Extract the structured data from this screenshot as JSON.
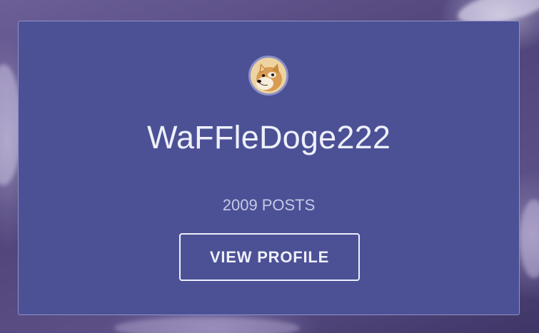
{
  "profile_card": {
    "username": "WaFFleDoge222",
    "post_count": "2009",
    "posts_label": "POSTS",
    "view_profile_label": "VIEW PROFILE",
    "avatar_icon": "doge-avatar-icon"
  },
  "colors": {
    "card_background": "#4c5196",
    "card_border": "#8f93c6",
    "text_primary": "#eef0fa",
    "text_secondary": "#c6c9e6",
    "avatar_ring": "#8d91c7"
  }
}
